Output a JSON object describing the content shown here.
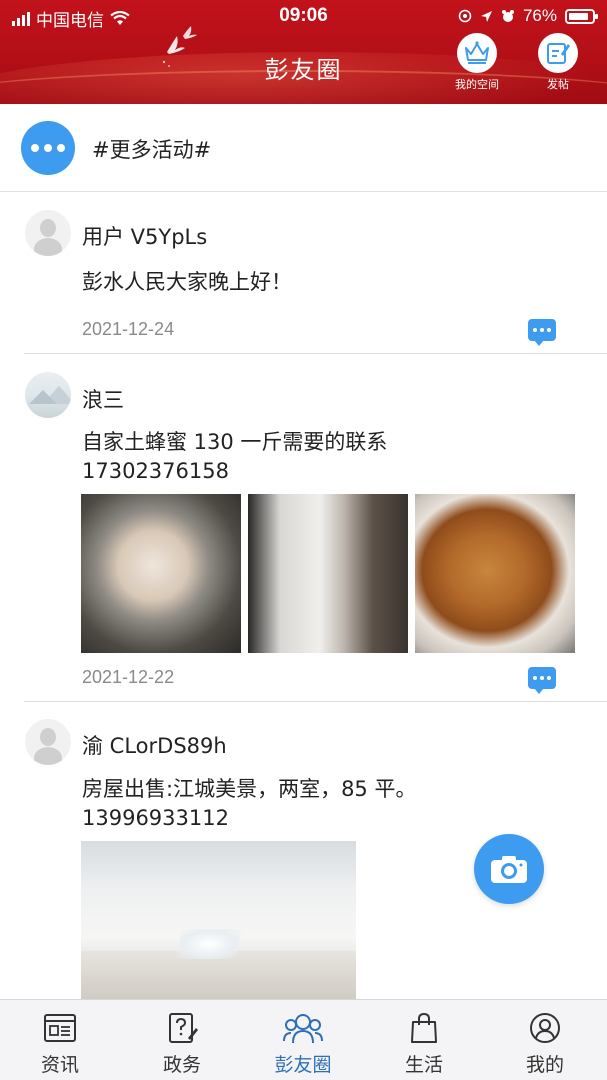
{
  "status_bar": {
    "carrier": "中国电信",
    "time": "09:06",
    "battery": "76%"
  },
  "header": {
    "title": "彭友圈",
    "my_space_label": "我的空间",
    "post_label": "发帖"
  },
  "activities": {
    "label": "#更多活动#"
  },
  "posts": [
    {
      "username": "用户 V5YpLs",
      "content": "彭水人民大家晚上好！",
      "date": "2021-12-24"
    },
    {
      "username": "浪三",
      "content_line1": "自家土蜂蜜 130 一斤需要的联系",
      "content_line2": "17302376158",
      "date": "2021-12-22"
    },
    {
      "username": "渝 CLorDS89h",
      "content_line1": "房屋出售:江城美景，两室，85 平。",
      "content_line2": "13996933112"
    }
  ],
  "tabbar": {
    "items": [
      {
        "label": "资讯"
      },
      {
        "label": "政务"
      },
      {
        "label": "彭友圈"
      },
      {
        "label": "生活"
      },
      {
        "label": "我的"
      }
    ]
  },
  "colors": {
    "header_red": "#b40f17",
    "accent_blue": "#3d9bf0",
    "active_tab": "#2f6fb7"
  }
}
